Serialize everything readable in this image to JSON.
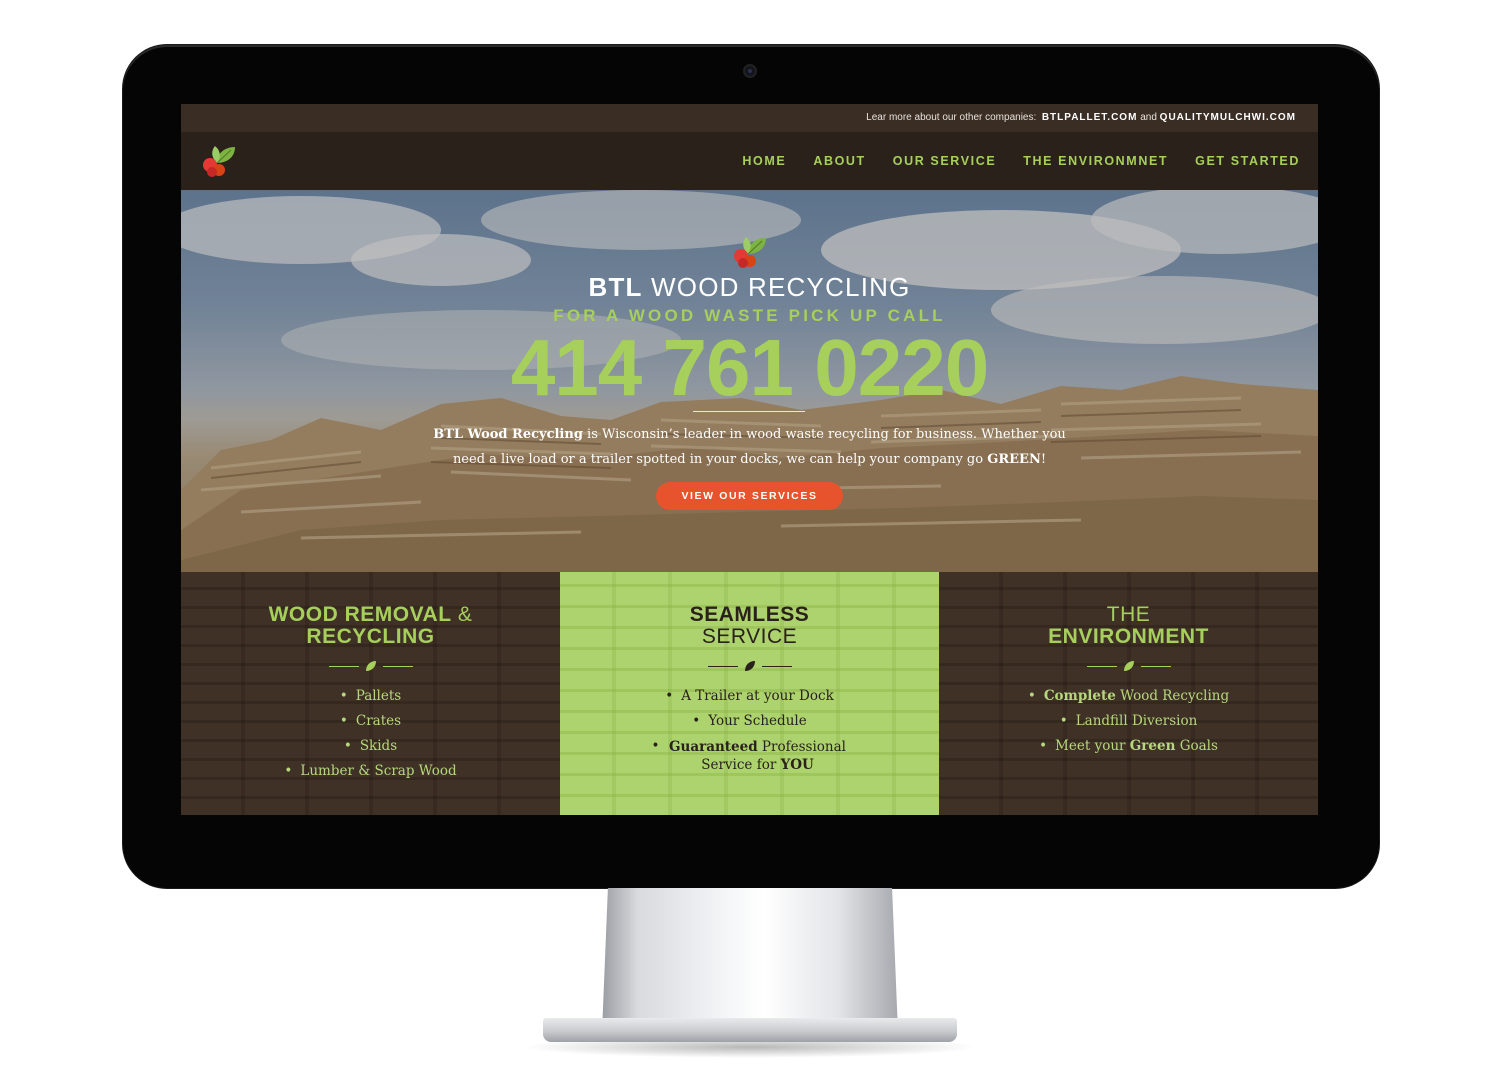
{
  "topbar": {
    "prefix": "Lear more about our other companies:",
    "link1": "BTLPALLET.COM",
    "conj": "and",
    "link2": "QUALITYMULCHWI.COM"
  },
  "nav": {
    "items": [
      "HOME",
      "ABOUT",
      "OUR SERVICE",
      "THE ENVIRONMNET",
      "GET STARTED"
    ]
  },
  "hero": {
    "title_bold": "BTL",
    "title_rest": "WOOD RECYCLING",
    "subtitle": "FOR A WOOD WASTE PICK UP CALL",
    "phone": "414 761 0220",
    "desc_bold": "BTL Wood Recycling",
    "desc_part1": " is Wisconsin’s leader in wood waste recycling for business. Whether you need a live load or a trailer spotted in your docks, we can help your company go ",
    "desc_green": "GREEN",
    "desc_end": "!",
    "cta": "VIEW OUR SERVICES"
  },
  "features": {
    "col1": {
      "head_line1": "WOOD REMOVAL",
      "head_amp": "&",
      "head_line2": "RECYCLING",
      "items": [
        "Pallets",
        "Crates",
        "Skids",
        "Lumber & Scrap Wood"
      ]
    },
    "col2": {
      "head_line1": "SEAMLESS",
      "head_line2": "SERVICE",
      "item1": "A Trailer at your Dock",
      "item2": "Your Schedule",
      "item3_bold": "Guaranteed",
      "item3_rest": " Professional Service for ",
      "item3_bold2": "YOU"
    },
    "col3": {
      "head_line1": "THE",
      "head_line2": "ENVIRONMENT",
      "item1_bold": "Complete",
      "item1_rest": " Wood Recycling",
      "item2": "Landfill Diversion",
      "item3_pre": "Meet your ",
      "item3_bold": "Green",
      "item3_post": " Goals"
    }
  },
  "colors": {
    "accent_green": "#a6cf5c",
    "cta_orange": "#e6532d",
    "dark_brown": "#2b211b"
  },
  "icons": {
    "logo": "leaf-berry-logo",
    "divider": "leaf-icon"
  }
}
